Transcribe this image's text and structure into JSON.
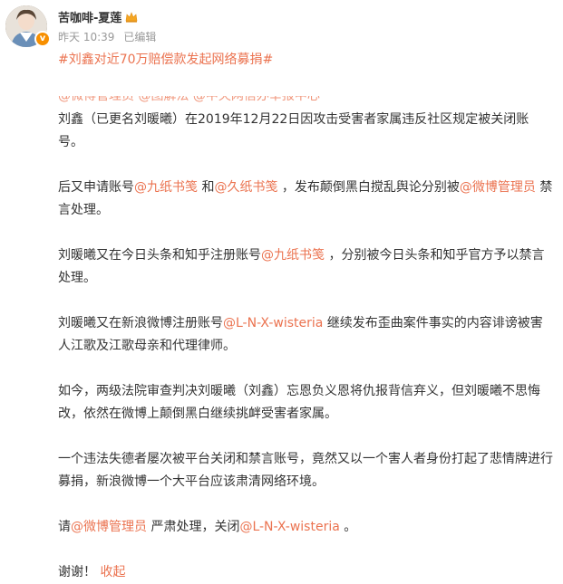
{
  "author": {
    "name": "苦咖啡-夏莲",
    "verified_badge": "v",
    "crown_icon": "crown-icon"
  },
  "meta": {
    "time": "昨天 10:39",
    "edited": "已编辑"
  },
  "post": {
    "hashtag": "#刘鑫对近70万赔偿款发起网络募捐#",
    "cut_line": "@微博管理员 @图解法 @中央网信办举报中心",
    "p1": "刘鑫（已更名刘暖曦）在2019年12月22日因攻击受害者家属违反社区规定被关闭账号。",
    "p2": {
      "a": "后又申请账号",
      "mention1": "@九纸书笺",
      "b": " 和",
      "mention2": "@久纸书笺",
      "c": " ，发布颠倒黑白搅乱舆论分别被",
      "mention3": "@微博管理员",
      "d": " 禁言处理。"
    },
    "p3": {
      "a": "刘暖曦又在今日头条和知乎注册账号",
      "mention": "@九纸书笺",
      "b": " ，分别被今日头条和知乎官方予以禁言处理。"
    },
    "p4": {
      "a": "刘暖曦又在新浪微博注册账号",
      "mention": "@L-N-X-wisteria",
      "b": " 继续发布歪曲案件事实的内容诽谤被害人江歌及江歌母亲和代理律师。"
    },
    "p5": "如今，两级法院审查判决刘暖曦（刘鑫）忘恩负义恩将仇报背信弃义，但刘暖曦不思悔改，依然在微博上颠倒黑白继续挑衅受害者家属。",
    "p6": "一个违法失德者屡次被平台关闭和禁言账号，竟然又以一个害人者身份打起了悲情牌进行募捐，新浪微博一个大平台应该肃清网络环境。",
    "p7": {
      "a": "请",
      "mention1": "@微博管理员",
      "b": " 严肃处理，关闭",
      "mention2": "@L-N-X-wisteria",
      "c": " 。"
    },
    "p8": {
      "a": "谢谢！ ",
      "collapse": "收起"
    }
  }
}
